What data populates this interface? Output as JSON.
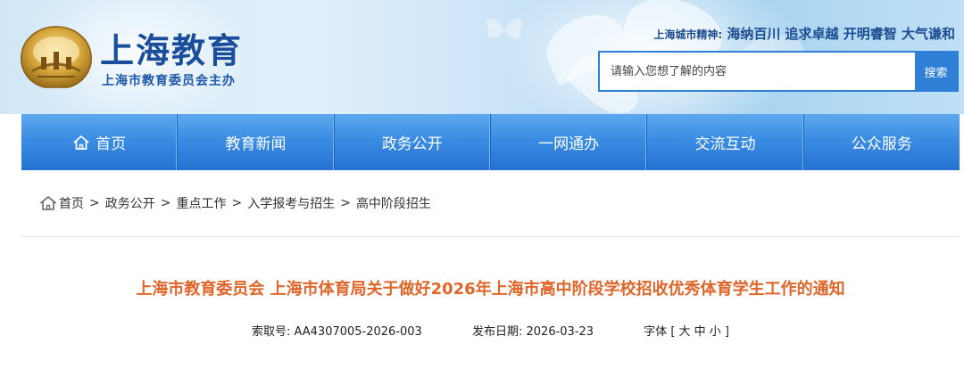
{
  "header": {
    "site_title": "上海教育",
    "site_subtitle": "上海市教育委员会主办",
    "spirit_label": "上海城市精神:",
    "spirit_value": "海纳百川 追求卓越 开明睿智 大气谦和",
    "search": {
      "placeholder": "请输入您想了解的内容",
      "button_label": "搜索"
    }
  },
  "nav": {
    "items": [
      {
        "label": "首页",
        "icon": "home-icon"
      },
      {
        "label": "教育新闻"
      },
      {
        "label": "政务公开"
      },
      {
        "label": "一网通办"
      },
      {
        "label": "交流互动"
      },
      {
        "label": "公众服务"
      }
    ]
  },
  "breadcrumb": {
    "icon": "home-icon",
    "items": [
      "首页",
      "政务公开",
      "重点工作",
      "入学报考与招生",
      "高中阶段招生"
    ],
    "separator": ">"
  },
  "article": {
    "title": "上海市教育委员会 上海市体育局关于做好2026年上海市高中阶段学校招收优秀体育学生工作的通知",
    "meta": {
      "index_label": "索取号:",
      "index_value": "AA4307005-2026-003",
      "date_label": "发布日期:",
      "date_value": "2026-03-23",
      "font_label": "字体 [ 大 中 小 ]"
    }
  },
  "colors": {
    "brand_blue": "#1a4e9a",
    "nav_blue": "#2f80d6",
    "title_orange": "#e0652a"
  }
}
